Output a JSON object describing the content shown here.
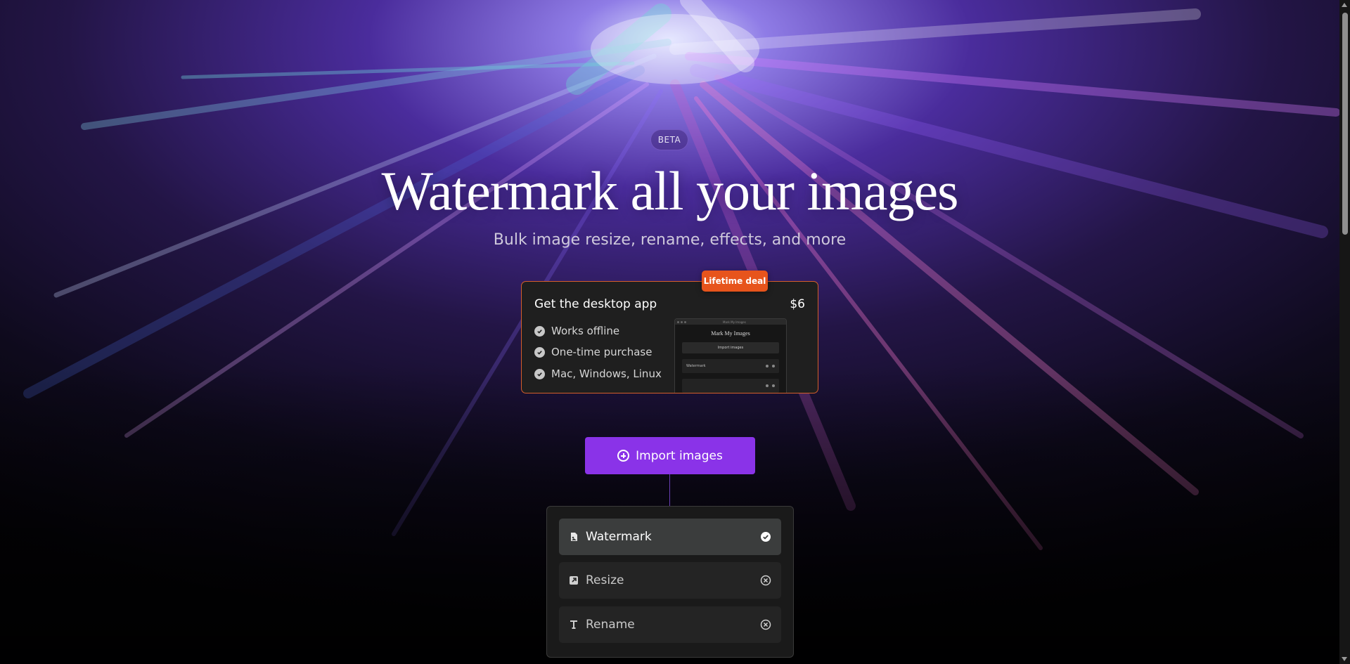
{
  "hero": {
    "badge": "BETA",
    "title": "Watermark all your images",
    "subtitle": "Bulk image resize, rename, effects, and more"
  },
  "promo": {
    "ribbon": "Lifetime deal",
    "title": "Get the desktop app",
    "price": "$6",
    "features": [
      "Works offline",
      "One-time purchase",
      "Mac, Windows, Linux"
    ],
    "preview": {
      "window_title": "Mark My Images",
      "heading": "Mark My Images",
      "import_label": "Import images",
      "row_label": "Watermark"
    },
    "accent_color": "#e7541c"
  },
  "actions": {
    "import_label": "Import images",
    "import_color": "#8a33e8"
  },
  "steps": [
    {
      "label": "Watermark",
      "state": "enabled",
      "icon": "file-image-icon",
      "status_icon": "check-circle-icon"
    },
    {
      "label": "Resize",
      "state": "disabled",
      "icon": "image-resize-icon",
      "status_icon": "x-circle-icon"
    },
    {
      "label": "Rename",
      "state": "disabled",
      "icon": "text-cursor-icon",
      "status_icon": "x-circle-icon"
    }
  ]
}
